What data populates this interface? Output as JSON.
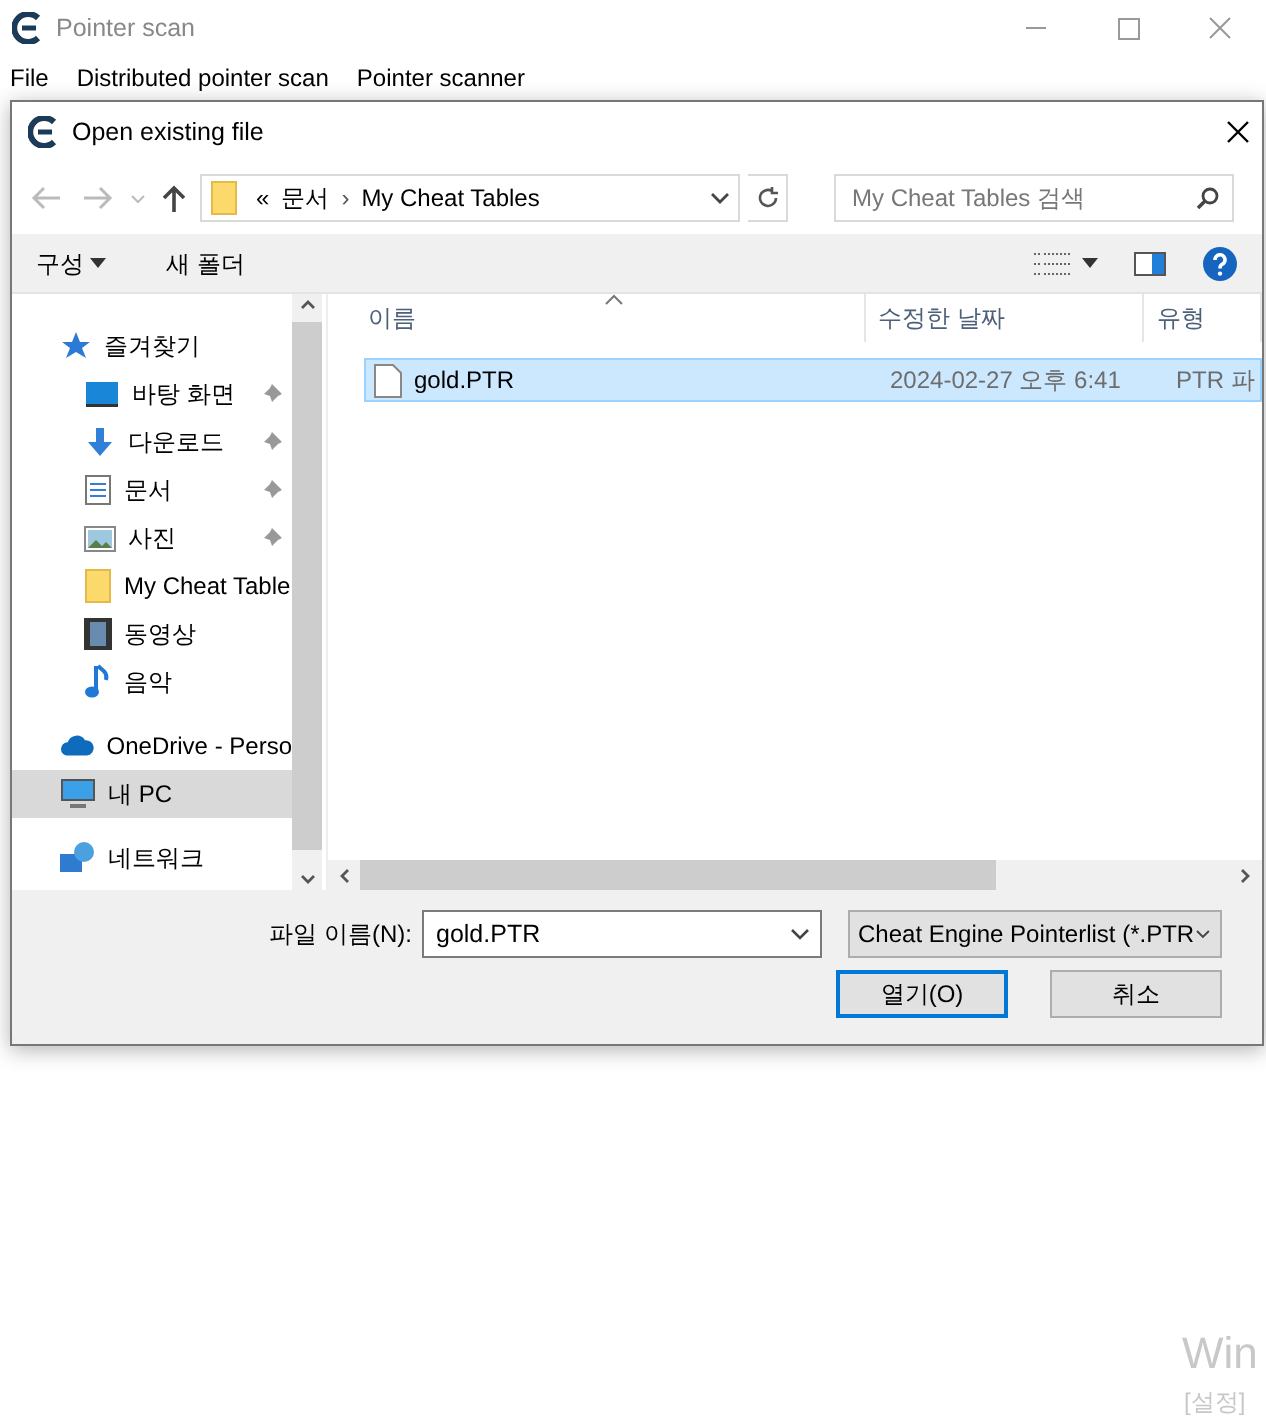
{
  "window": {
    "title": "Pointer scan"
  },
  "menu": [
    "File",
    "Distributed pointer scan",
    "Pointer scanner"
  ],
  "dialog": {
    "title": "Open existing file",
    "address": {
      "overflow": "«",
      "separator": "›",
      "crumbs": [
        "문서",
        "My Cheat Tables"
      ]
    },
    "search": {
      "placeholder": "My Cheat Tables 검색"
    },
    "toolbar": {
      "organize": "구성",
      "new_folder": "새 폴더"
    },
    "sidebar": [
      {
        "label": "즐겨찾기",
        "kind": "star",
        "selected": false,
        "children": [
          {
            "label": "바탕 화면",
            "kind": "desktop",
            "pinned": true,
            "selected": false
          },
          {
            "label": "다운로드",
            "kind": "download",
            "pinned": true,
            "selected": false
          },
          {
            "label": "문서",
            "kind": "document",
            "pinned": true,
            "selected": false
          },
          {
            "label": "사진",
            "kind": "photo",
            "pinned": true,
            "selected": false
          },
          {
            "label": "My Cheat Table",
            "kind": "folder",
            "pinned": false,
            "selected": false
          },
          {
            "label": "동영상",
            "kind": "film",
            "pinned": false,
            "selected": false
          },
          {
            "label": "음악",
            "kind": "music",
            "pinned": false,
            "selected": false
          }
        ]
      },
      {
        "label": "OneDrive - Perso",
        "kind": "cloud",
        "selected": false
      },
      {
        "label": "내 PC",
        "kind": "pc",
        "selected": true
      },
      {
        "label": "네트워크",
        "kind": "network",
        "selected": false
      }
    ],
    "columns": [
      "이름",
      "수정한 날짜",
      "유형"
    ],
    "files": [
      {
        "name": "gold.PTR",
        "modified": "2024-02-27 오후 6:41",
        "type": "PTR 파",
        "selected": true
      }
    ],
    "filename": {
      "label": "파일 이름(N):",
      "value": "gold.PTR"
    },
    "filetype": "Cheat Engine Pointerlist (*.PTR",
    "buttons": [
      {
        "label": "열기(O)",
        "default": true
      },
      {
        "label": "취소",
        "default": false
      }
    ]
  },
  "activation_notice": {
    "line_1": "Win",
    "line_2": "[설정]"
  }
}
